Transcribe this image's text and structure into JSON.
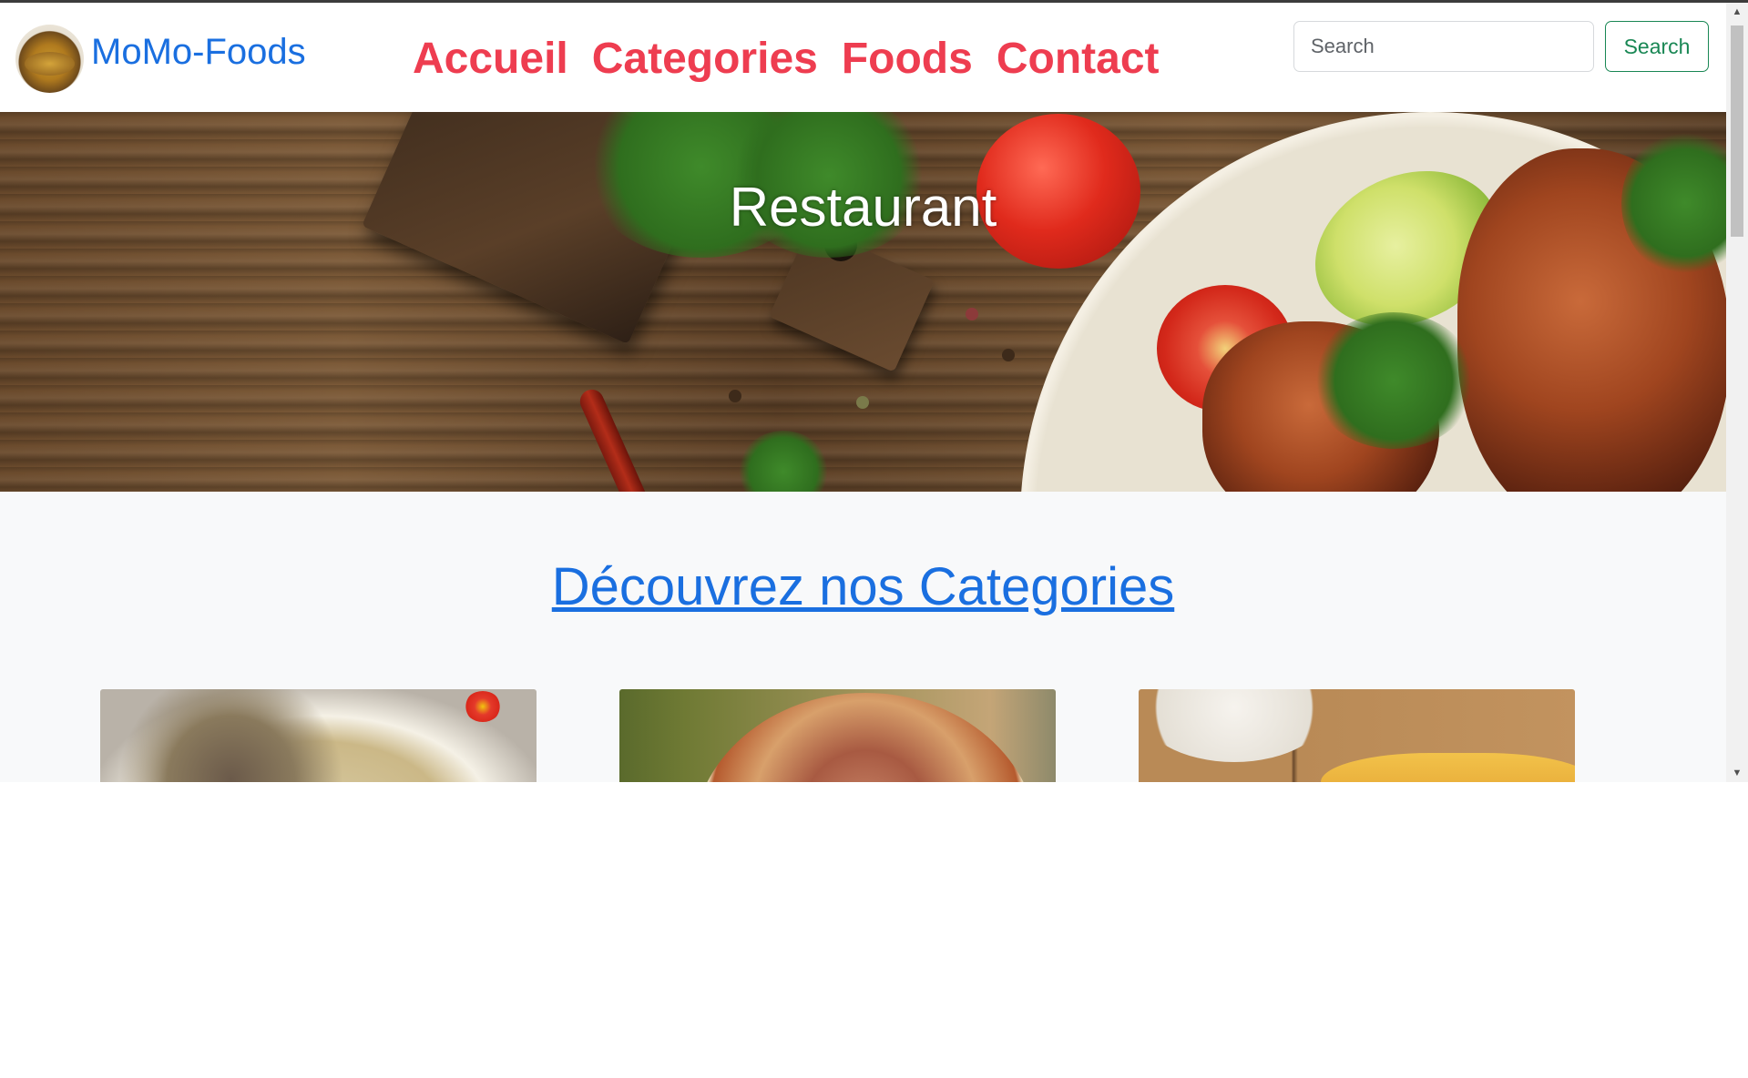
{
  "navbar": {
    "brand": "MoMo-Foods",
    "links": [
      {
        "label": "Accueil"
      },
      {
        "label": "Categories"
      },
      {
        "label": "Foods"
      },
      {
        "label": "Contact"
      }
    ],
    "search": {
      "placeholder": "Search",
      "button_label": "Search"
    }
  },
  "hero": {
    "title": "Restaurant"
  },
  "categories_section": {
    "title": "Découvrez nos Categories",
    "cards": [
      {
        "image": "category-image-1"
      },
      {
        "image": "category-image-2"
      },
      {
        "image": "category-image-3"
      }
    ]
  },
  "colors": {
    "brand_blue": "#1a6fe0",
    "nav_red": "#ee3d50",
    "search_green": "#198754",
    "section_bg": "#f8f9fa"
  },
  "icons": {
    "logo": "food-plate-logo",
    "scroll_up": "scroll-up-arrow-icon",
    "scroll_down": "scroll-down-arrow-icon"
  }
}
